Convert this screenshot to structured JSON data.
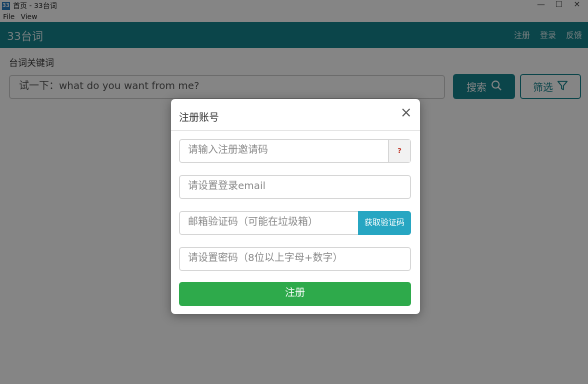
{
  "window": {
    "title": "首页 - 33台词",
    "icon_text": "33",
    "controls": {
      "minimize": "—",
      "maximize": "☐",
      "close": "✕"
    }
  },
  "menu": {
    "items": [
      "File",
      "View"
    ]
  },
  "navbar": {
    "brand": "33台词",
    "links": {
      "register": "注册",
      "login": "登录",
      "feedback": "反馈"
    }
  },
  "search": {
    "label": "台词关键词",
    "value": "试一下：what do you want from me?",
    "search_button": "搜索",
    "filter_button": "筛选"
  },
  "modal": {
    "title": "注册账号",
    "close": "×",
    "invite_placeholder": "请输入注册邀请码",
    "invite_help": "?",
    "email_placeholder": "请设置登录email",
    "code_placeholder": "邮箱验证码（可能在垃圾箱）",
    "get_code_button": "获取验证码",
    "password_placeholder": "请设置密码（8位以上字母+数字）",
    "submit": "注册"
  },
  "colors": {
    "primary": "#16848f",
    "info": "#27a6c2",
    "success": "#2eaa4b"
  }
}
